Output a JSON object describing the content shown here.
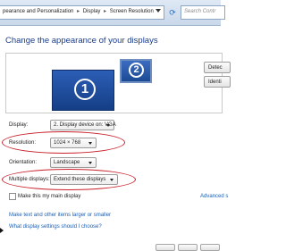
{
  "address_bar": {
    "breadcrumb": [
      "pearance and Personalization",
      "Display",
      "Screen Resolution"
    ],
    "search_placeholder": "Search Contr"
  },
  "page": {
    "title": "Change the appearance of your displays"
  },
  "preview": {
    "monitor_1_number": "1",
    "monitor_2_number": "2",
    "detect_label": "Detec",
    "identify_label": "Identi"
  },
  "settings": {
    "display": {
      "label": "Display:",
      "value": "2. Display device on: VGA"
    },
    "resolution": {
      "label": "Resolution:",
      "value": "1024 × 768"
    },
    "orientation": {
      "label": "Orientation:",
      "value": "Landscape"
    },
    "multiple_displays": {
      "label": "Multiple displays:",
      "value": "Extend these displays"
    }
  },
  "main_display_checkbox": {
    "label": "Make this my main display",
    "checked": false
  },
  "advanced_link": "Advanced s",
  "links": {
    "text_size": "Make text and other items larger or smaller",
    "which_settings": "What display settings should I choose?"
  },
  "colors": {
    "heading": "#1a3c8a",
    "link": "#1a5fb4",
    "highlight": "#c8202a",
    "monitor": "#1f4f9f"
  },
  "icons": [
    "refresh-icon",
    "dropdown-arrow-icon",
    "mouse-pointer-icon"
  ]
}
